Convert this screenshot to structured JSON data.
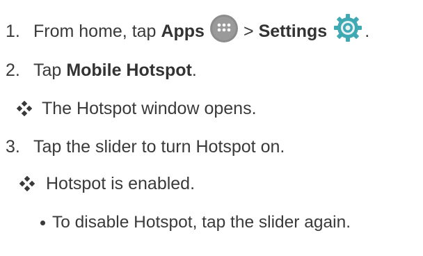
{
  "steps": [
    {
      "number": "1.",
      "text_prefix": "From home, tap",
      "apps_label": "Apps",
      "separator": ">",
      "settings_label": "Settings",
      "end": ".",
      "icons": [
        "apps-icon",
        "settings-icon"
      ]
    },
    {
      "number": "2.",
      "text_prefix": "Tap",
      "bold": "Mobile Hotspot",
      "end": "."
    },
    {
      "result_icon": "diamond-bullet-icon",
      "result": "The Hotspot window opens."
    },
    {
      "number": "3.",
      "text": "Tap the slider to turn Hotspot on."
    },
    {
      "result_icon": "diamond-bullet-icon",
      "result": "Hotspot is enabled."
    },
    {
      "bullet": "To disable Hotspot, tap the slider again."
    }
  ],
  "colors": {
    "text": "#3a3a3a",
    "apps_icon": "#8c8c8c",
    "settings_icon": "#3fa9b4",
    "diamond": "#3a3a3a"
  }
}
